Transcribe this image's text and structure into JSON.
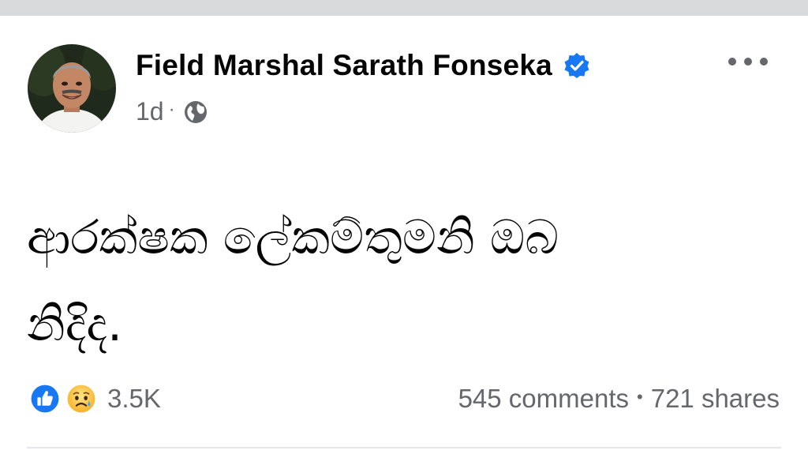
{
  "post": {
    "author_name": "Field Marshal Sarath Fonseka",
    "time": "1d",
    "separator": "·",
    "audience_icon": "globe-icon",
    "more_icon": "more-options-icon",
    "verified_icon": "verified-badge-icon",
    "text_line1": "ආරක්ෂක ලේකම්තුමනි ඔබ",
    "text_line2": "නිදිද."
  },
  "reactions": {
    "icons": [
      "like-icon",
      "sad-icon"
    ],
    "count": "3.5K"
  },
  "stats": {
    "comments": "545 comments",
    "separator": "•",
    "shares": "721 shares"
  },
  "colors": {
    "brand_blue": "#1877f2",
    "secondary_text": "#65676b",
    "primary_text": "#050505",
    "top_strip": "#d9dadc"
  }
}
